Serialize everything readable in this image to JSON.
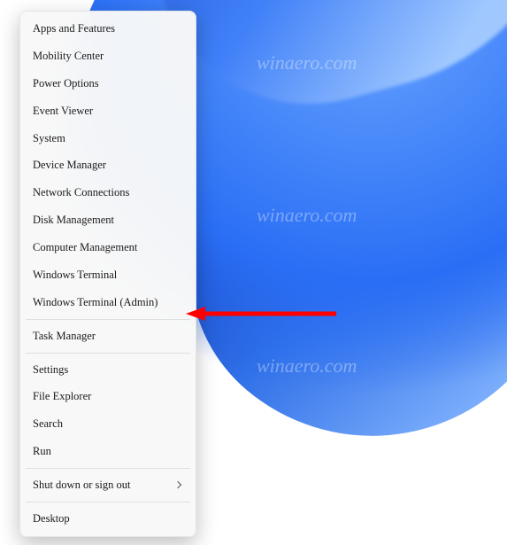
{
  "watermark": "winaero.com",
  "menu": {
    "groups": [
      [
        {
          "label": "Apps and Features",
          "name": "apps-and-features",
          "submenu": false
        },
        {
          "label": "Mobility Center",
          "name": "mobility-center",
          "submenu": false
        },
        {
          "label": "Power Options",
          "name": "power-options",
          "submenu": false
        },
        {
          "label": "Event Viewer",
          "name": "event-viewer",
          "submenu": false
        },
        {
          "label": "System",
          "name": "system",
          "submenu": false
        },
        {
          "label": "Device Manager",
          "name": "device-manager",
          "submenu": false
        },
        {
          "label": "Network Connections",
          "name": "network-connections",
          "submenu": false
        },
        {
          "label": "Disk Management",
          "name": "disk-management",
          "submenu": false
        },
        {
          "label": "Computer Management",
          "name": "computer-management",
          "submenu": false
        },
        {
          "label": "Windows Terminal",
          "name": "windows-terminal",
          "submenu": false
        },
        {
          "label": "Windows Terminal (Admin)",
          "name": "windows-terminal-admin",
          "submenu": false
        }
      ],
      [
        {
          "label": "Task Manager",
          "name": "task-manager",
          "submenu": false
        }
      ],
      [
        {
          "label": "Settings",
          "name": "settings",
          "submenu": false
        },
        {
          "label": "File Explorer",
          "name": "file-explorer",
          "submenu": false
        },
        {
          "label": "Search",
          "name": "search",
          "submenu": false
        },
        {
          "label": "Run",
          "name": "run",
          "submenu": false
        }
      ],
      [
        {
          "label": "Shut down or sign out",
          "name": "shut-down-or-sign-out",
          "submenu": true
        }
      ],
      [
        {
          "label": "Desktop",
          "name": "desktop",
          "submenu": false
        }
      ]
    ]
  },
  "annotation": {
    "target": "windows-terminal-admin",
    "color": "#ff0000"
  }
}
